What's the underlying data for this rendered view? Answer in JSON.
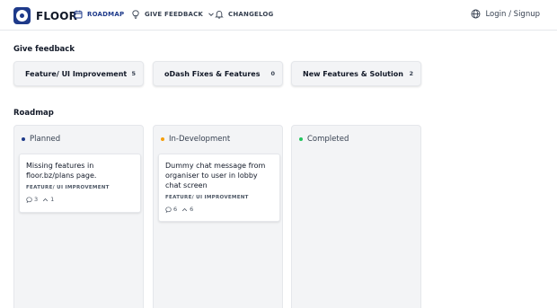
{
  "brand": {
    "name": "FLOOR",
    "accent": "#1e3a8a"
  },
  "nav": {
    "roadmap": {
      "label": "ROADMAP",
      "icon": "calendar-icon"
    },
    "give_feedback": {
      "label": "GIVE FEEDBACK",
      "icon": "lightbulb-icon"
    },
    "changelog": {
      "label": "CHANGELOG",
      "icon": "bell-icon"
    }
  },
  "account": {
    "label": "Login / Signup",
    "icon": "globe-icon"
  },
  "feedback": {
    "title": "Give feedback",
    "boards": [
      {
        "name": "Feature/ UI Improvement",
        "count": "5"
      },
      {
        "name": "oDash Fixes & Features",
        "count": "0"
      },
      {
        "name": "New Features & Solution",
        "count": "2"
      }
    ]
  },
  "roadmap": {
    "title": "Roadmap",
    "columns": [
      {
        "name": "Planned",
        "color": "#1e3a8a",
        "posts": [
          {
            "title": "Missing features in floor.bz/plans page.",
            "tag": "FEATURE/ UI IMPROVEMENT",
            "comments": "3",
            "votes": "1"
          }
        ]
      },
      {
        "name": "In-Development",
        "color": "#f59e0b",
        "posts": [
          {
            "title": "Dummy chat message from organiser to user in lobby chat screen",
            "tag": "FEATURE/ UI IMPROVEMENT",
            "comments": "6",
            "votes": "6"
          }
        ]
      },
      {
        "name": "Completed",
        "color": "#22c55e",
        "posts": []
      }
    ]
  }
}
